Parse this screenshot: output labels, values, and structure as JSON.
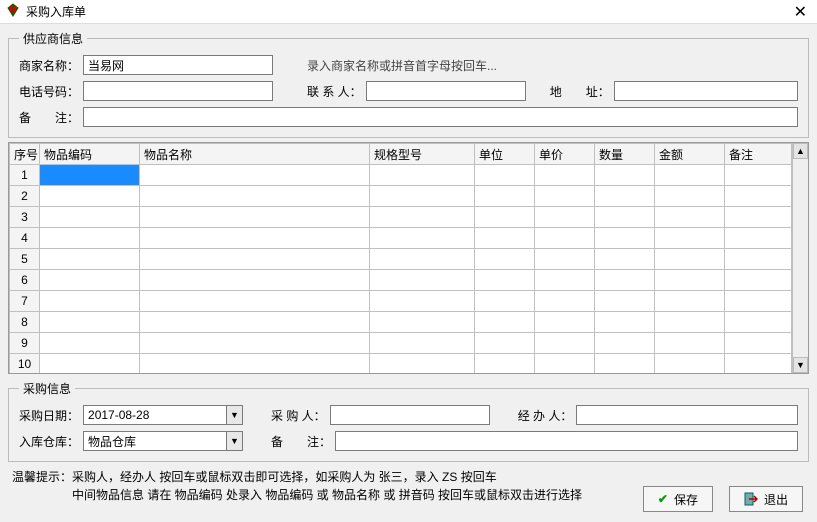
{
  "window": {
    "title": "采购入库单"
  },
  "supplier": {
    "legend": "供应商信息",
    "name_label": "商家名称：",
    "name_value": "当易网",
    "hint": "录入商家名称或拼音首字母按回车...",
    "phone_label": "电话号码：",
    "phone_value": "",
    "contact_label": "联 系 人：",
    "contact_value": "",
    "address_label": "地　　址：",
    "address_value": "",
    "remark_label": "备　　注：",
    "remark_value": ""
  },
  "grid": {
    "columns": [
      "序号",
      "物品编码",
      "物品名称",
      "规格型号",
      "单位",
      "单价",
      "数量",
      "金额",
      "备注"
    ],
    "rows": [
      {
        "n": "1",
        "code": "",
        "name": "",
        "spec": "",
        "unit": "",
        "price": "",
        "qty": "",
        "amount": "",
        "note": ""
      },
      {
        "n": "2",
        "code": "",
        "name": "",
        "spec": "",
        "unit": "",
        "price": "",
        "qty": "",
        "amount": "",
        "note": ""
      },
      {
        "n": "3",
        "code": "",
        "name": "",
        "spec": "",
        "unit": "",
        "price": "",
        "qty": "",
        "amount": "",
        "note": ""
      },
      {
        "n": "4",
        "code": "",
        "name": "",
        "spec": "",
        "unit": "",
        "price": "",
        "qty": "",
        "amount": "",
        "note": ""
      },
      {
        "n": "5",
        "code": "",
        "name": "",
        "spec": "",
        "unit": "",
        "price": "",
        "qty": "",
        "amount": "",
        "note": ""
      },
      {
        "n": "6",
        "code": "",
        "name": "",
        "spec": "",
        "unit": "",
        "price": "",
        "qty": "",
        "amount": "",
        "note": ""
      },
      {
        "n": "7",
        "code": "",
        "name": "",
        "spec": "",
        "unit": "",
        "price": "",
        "qty": "",
        "amount": "",
        "note": ""
      },
      {
        "n": "8",
        "code": "",
        "name": "",
        "spec": "",
        "unit": "",
        "price": "",
        "qty": "",
        "amount": "",
        "note": ""
      },
      {
        "n": "9",
        "code": "",
        "name": "",
        "spec": "",
        "unit": "",
        "price": "",
        "qty": "",
        "amount": "",
        "note": ""
      },
      {
        "n": "10",
        "code": "",
        "name": "",
        "spec": "",
        "unit": "",
        "price": "",
        "qty": "",
        "amount": "",
        "note": ""
      }
    ]
  },
  "purchase": {
    "legend": "采购信息",
    "date_label": "采购日期：",
    "date_value": "2017-08-28",
    "warehouse_label": "入库仓库：",
    "warehouse_value": "物品仓库",
    "buyer_label": "采 购 人：",
    "buyer_value": "",
    "handler_label": "经 办 人：",
    "handler_value": "",
    "remark_label": "备　　注：",
    "remark_value": ""
  },
  "tips": {
    "label": "温馨提示：",
    "line1": "采购人，经办人 按回车或鼠标双击即可选择，如采购人为 张三，录入 ZS 按回车",
    "line2": "中间物品信息 请在 物品编码 处录入 物品编码 或 物品名称 或 拼音码 按回车或鼠标双击进行选择"
  },
  "buttons": {
    "save": "保存",
    "exit": "退出"
  }
}
